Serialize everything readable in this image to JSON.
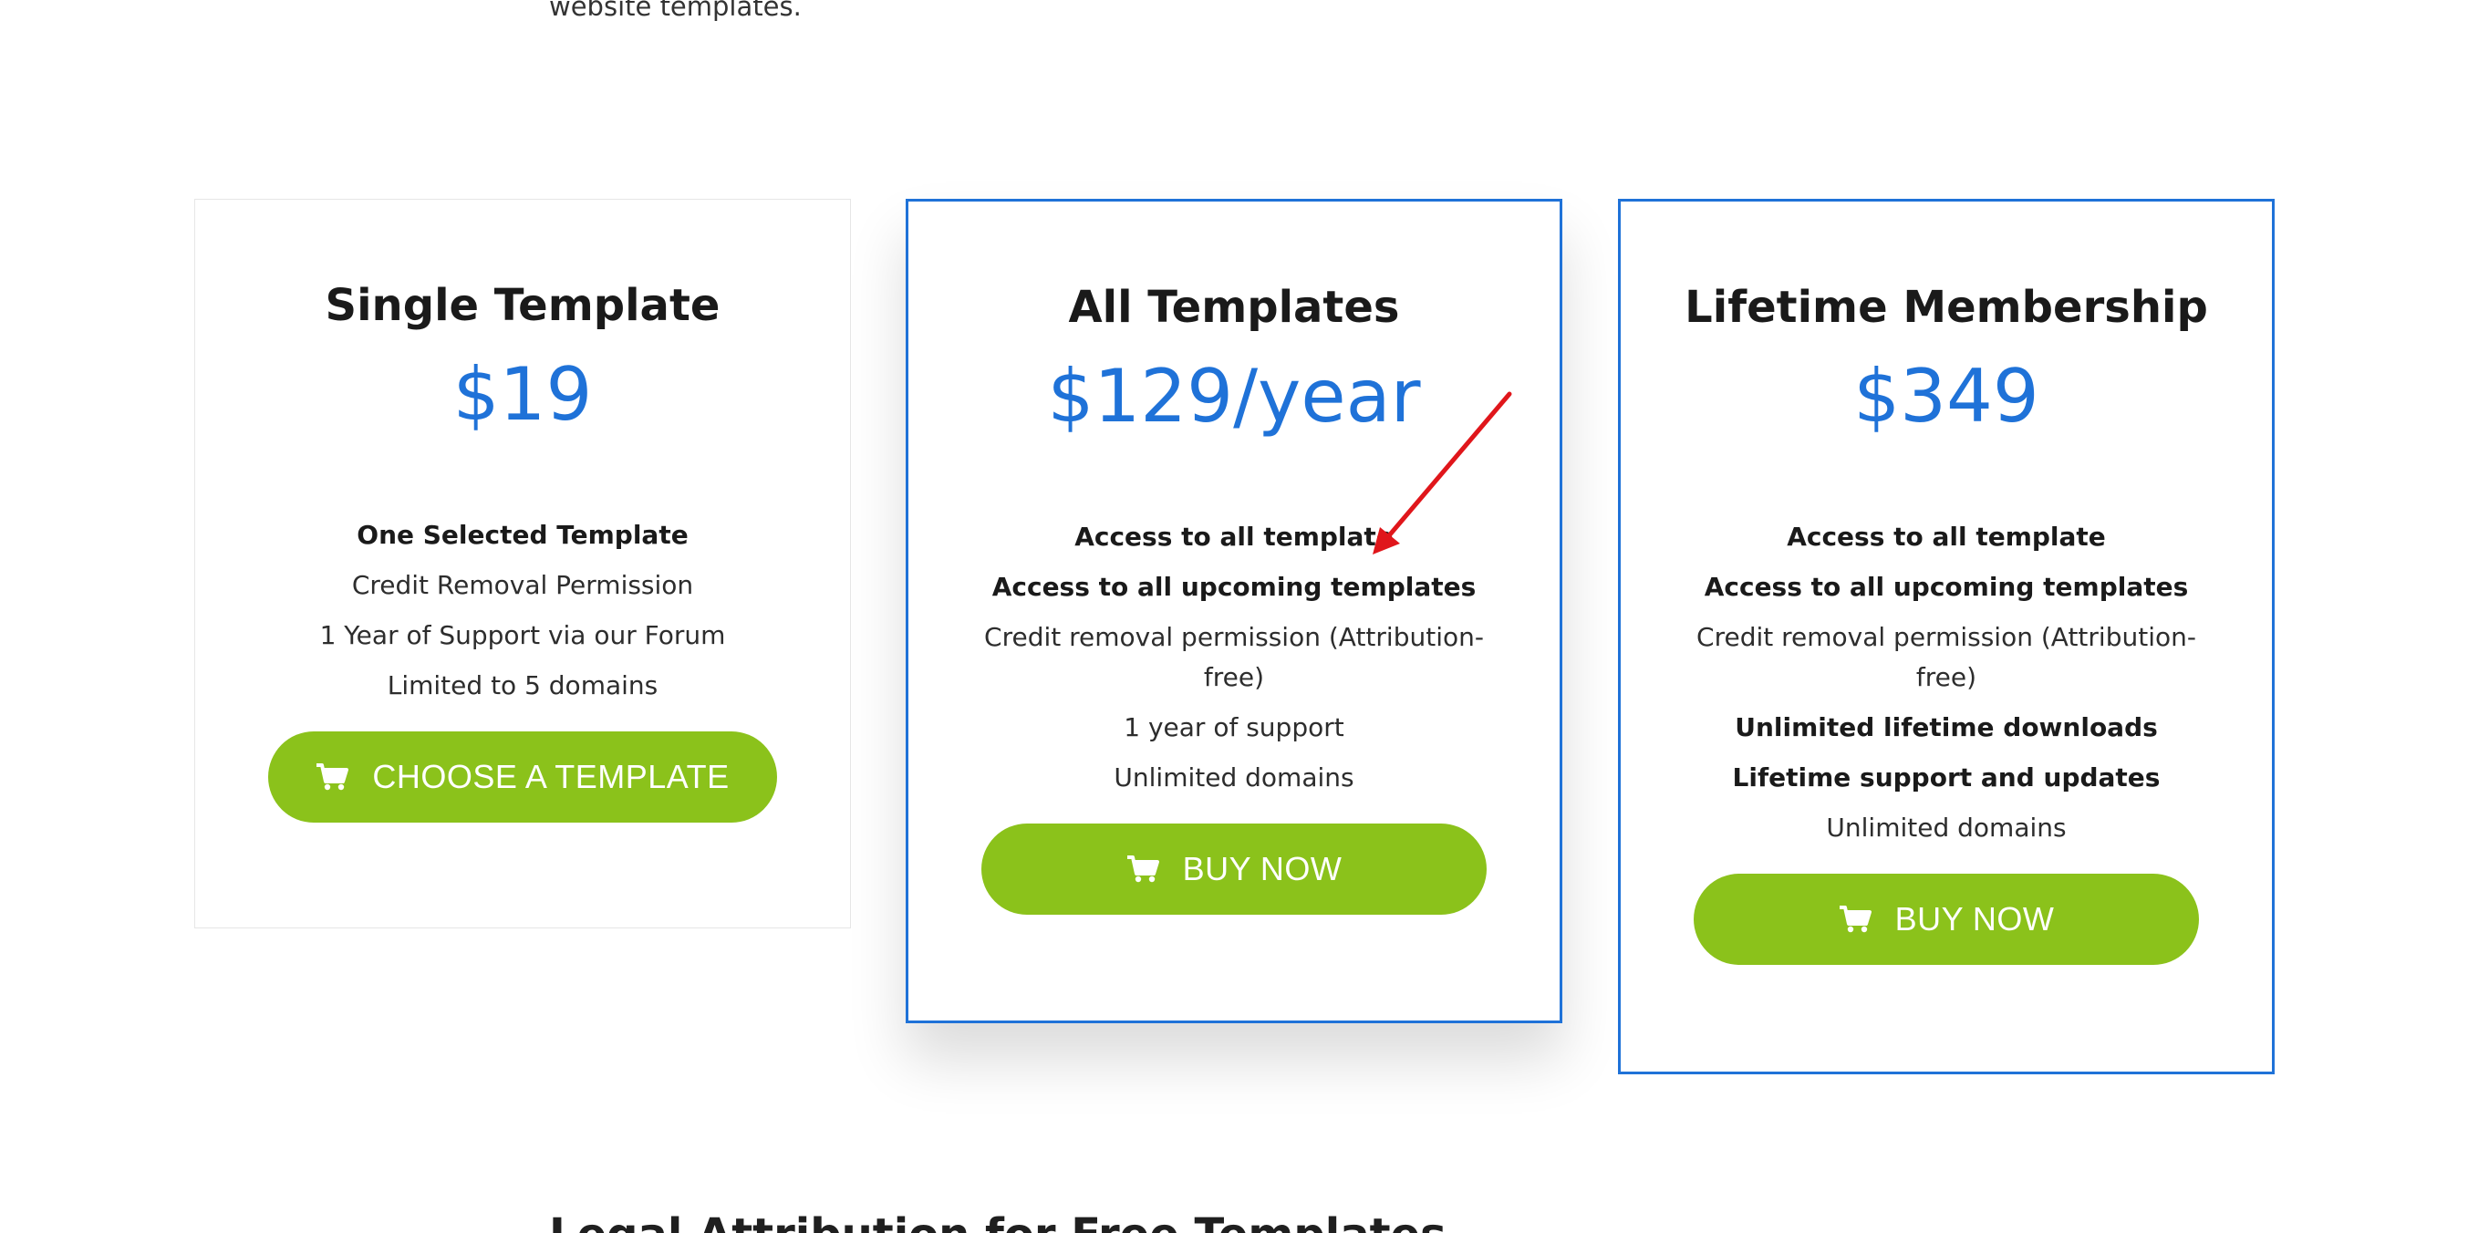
{
  "intro": {
    "text": "website templates."
  },
  "plans": [
    {
      "title": "Single Template",
      "price": "$19",
      "features": [
        {
          "text": "One Selected Template",
          "bold": true
        },
        {
          "text": "Credit Removal Permission",
          "bold": false
        },
        {
          "text": "1 Year of Support via our Forum",
          "bold": false
        },
        {
          "text": "Limited to 5 domains",
          "bold": false
        }
      ],
      "cta": {
        "label": "CHOOSE A TEMPLATE",
        "icon": "cart-icon"
      }
    },
    {
      "title": "All Templates",
      "price": "$129/year",
      "features": [
        {
          "text": "Access to all template",
          "bold": true
        },
        {
          "text": "Access to all upcoming templates",
          "bold": true
        },
        {
          "text": "Credit removal permission (Attribution-free)",
          "bold": false
        },
        {
          "text": "1 year of support",
          "bold": false
        },
        {
          "text": "Unlimited domains",
          "bold": false
        }
      ],
      "cta": {
        "label": "BUY NOW",
        "icon": "cart-icon"
      }
    },
    {
      "title": "Lifetime Membership",
      "price": "$349",
      "features": [
        {
          "text": "Access to all template",
          "bold": true
        },
        {
          "text": "Access to all upcoming templates",
          "bold": true
        },
        {
          "text": "Credit removal permission (Attribution-free)",
          "bold": false
        },
        {
          "text": "Unlimited lifetime downloads",
          "bold": true
        },
        {
          "text": "Lifetime support and updates",
          "bold": true
        },
        {
          "text": "Unlimited domains",
          "bold": false
        }
      ],
      "cta": {
        "label": "BUY NOW",
        "icon": "cart-icon"
      }
    }
  ],
  "section_heading": "Legal Attribution for Free Templates",
  "colors": {
    "accent": "#1f72d8",
    "button": "#8bc21b",
    "annotation_arrow": "#e0161b"
  }
}
